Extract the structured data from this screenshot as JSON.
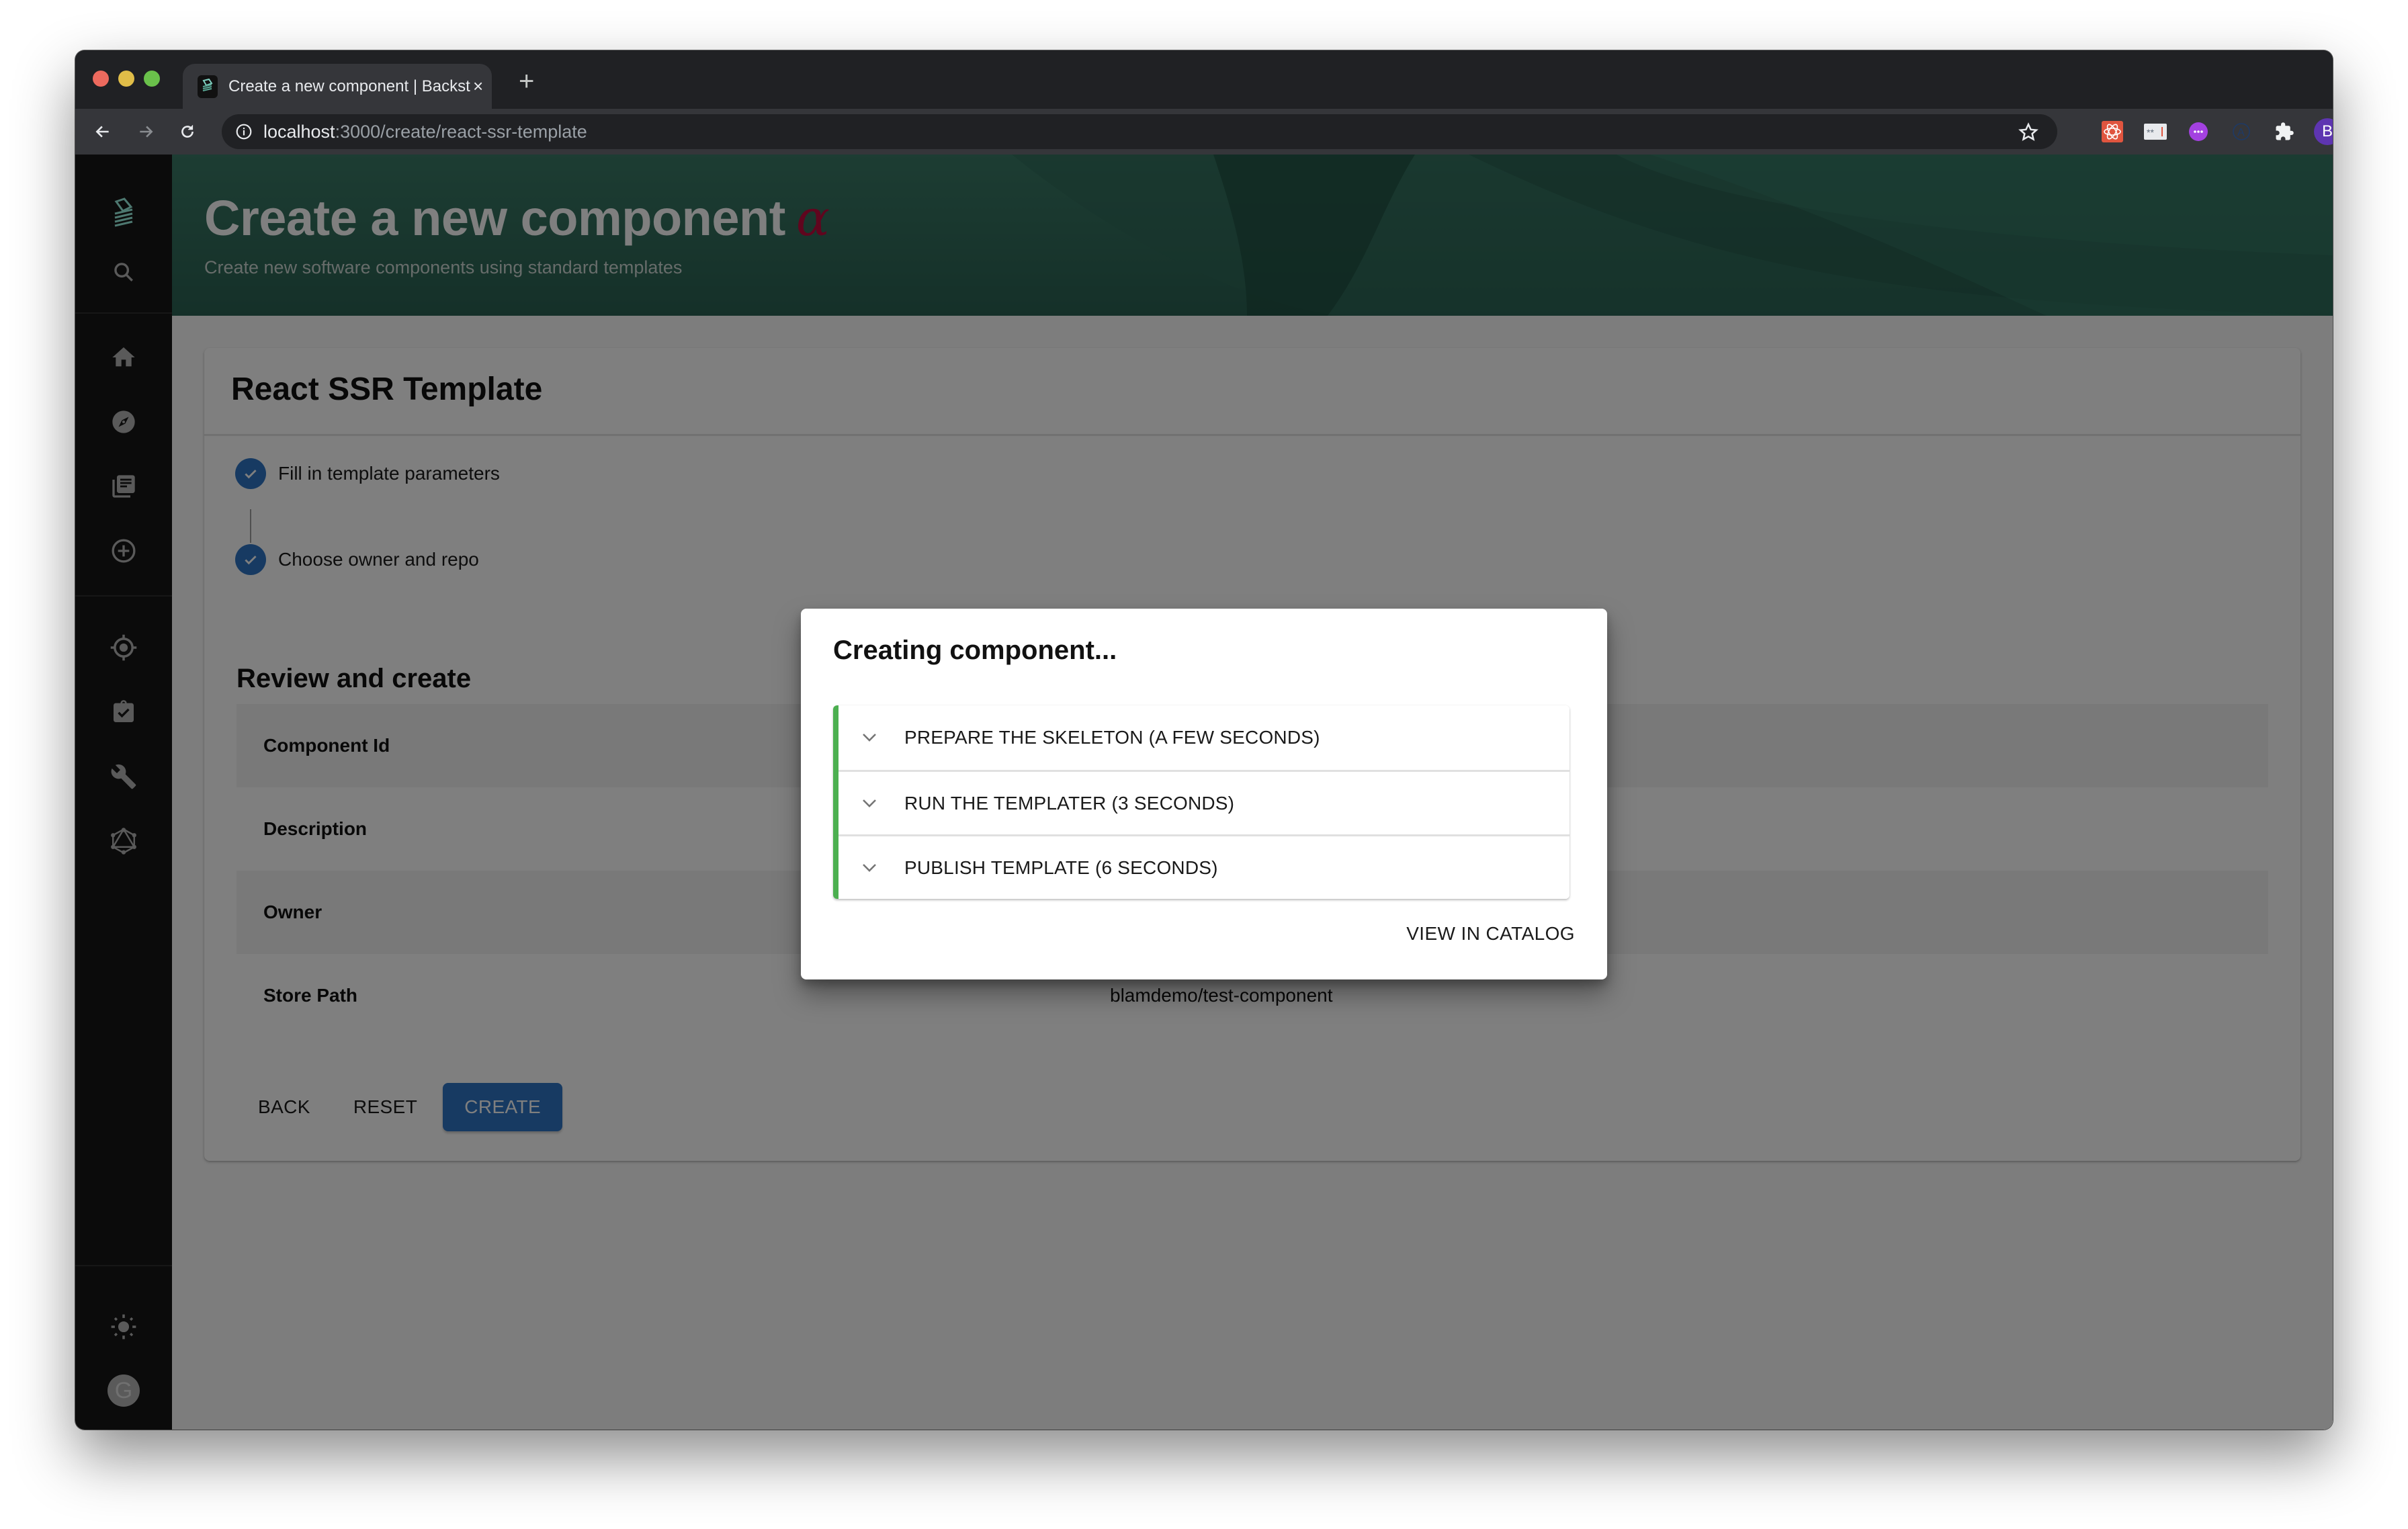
{
  "browser": {
    "tab_title": "Create a new component | Backstage",
    "tab_close": "×",
    "new_tab": "+",
    "url_host": "localhost",
    "url_path": ":3000/create/react-ssr-template",
    "profile_initial": "B"
  },
  "header": {
    "title": "Create a new component",
    "alpha": "α",
    "subtitle": "Create new software components using standard templates"
  },
  "sidebar": {
    "items": [
      "logo",
      "search",
      "home",
      "explore",
      "docs",
      "create",
      "tech-radar",
      "cost-insights",
      "tools",
      "graphiql"
    ],
    "bottom": [
      "settings-theme",
      "user-profile"
    ],
    "user_initial": "G"
  },
  "card": {
    "title": "React SSR Template",
    "steps": [
      {
        "label": "Fill in template parameters",
        "completed": true
      },
      {
        "label": "Choose owner and repo",
        "completed": true
      }
    ],
    "review_title": "Review and create",
    "review_rows": [
      {
        "key": "Component Id",
        "value": ""
      },
      {
        "key": "Description",
        "value": ""
      },
      {
        "key": "Owner",
        "value": ""
      },
      {
        "key": "Store Path",
        "value": "blamdemo/test-component"
      }
    ],
    "buttons": {
      "back": "BACK",
      "reset": "RESET",
      "create": "CREATE"
    }
  },
  "modal": {
    "title": "Creating component...",
    "steps": [
      {
        "label": "PREPARE THE SKELETON (A FEW SECONDS)"
      },
      {
        "label": "RUN THE TEMPLATER (3 SECONDS)"
      },
      {
        "label": "PUBLISH TEMPLATE (6 SECONDS)"
      }
    ],
    "action": "VIEW IN CATALOG",
    "status_color": "#4caf50"
  },
  "colors": {
    "primary": "#2e75c4",
    "header_green": "#2a6152",
    "alpha_red": "#c00a3c"
  }
}
